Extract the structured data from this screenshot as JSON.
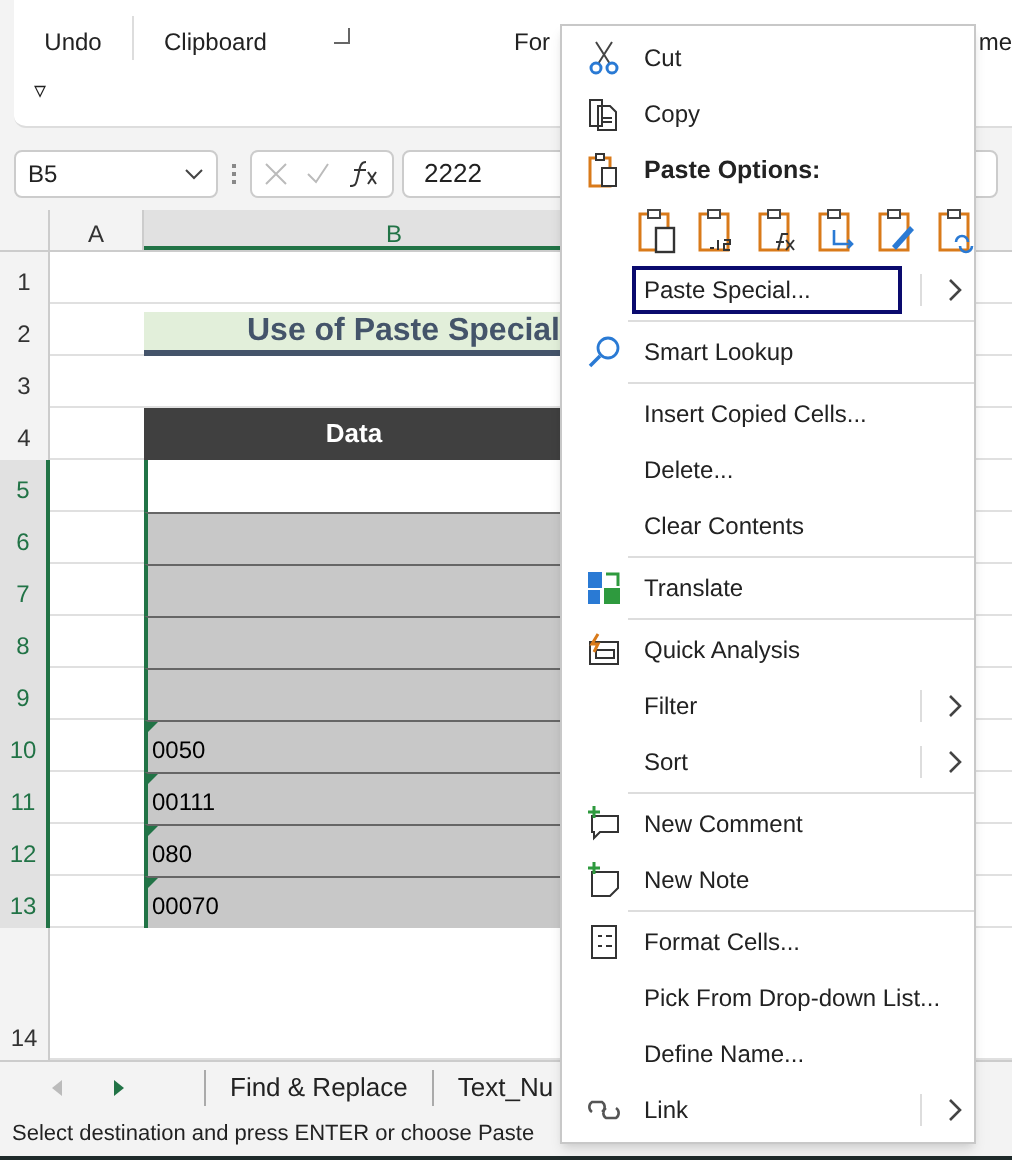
{
  "ribbon": {
    "groups": [
      "Undo",
      "Clipboard",
      "For",
      "me"
    ],
    "collapse": "▿"
  },
  "formula_bar": {
    "name_box": "B5",
    "value": "2222"
  },
  "columns": [
    "A",
    "B"
  ],
  "rows": [
    {
      "header": "1",
      "kind": "blank",
      "value": ""
    },
    {
      "header": "2",
      "kind": "title",
      "value": "Use of Paste Special"
    },
    {
      "header": "3",
      "kind": "blank",
      "value": ""
    },
    {
      "header": "4",
      "kind": "heading",
      "value": "Data"
    },
    {
      "header": "5",
      "kind": "data",
      "value": "",
      "shaded": false,
      "flag": false
    },
    {
      "header": "6",
      "kind": "data",
      "value": "",
      "shaded": true,
      "flag": false
    },
    {
      "header": "7",
      "kind": "data",
      "value": "",
      "shaded": true,
      "flag": false
    },
    {
      "header": "8",
      "kind": "data",
      "value": "",
      "shaded": true,
      "flag": false
    },
    {
      "header": "9",
      "kind": "data",
      "value": "",
      "shaded": true,
      "flag": false
    },
    {
      "header": "10",
      "kind": "data",
      "value": "0050",
      "shaded": true,
      "flag": true
    },
    {
      "header": "11",
      "kind": "data",
      "value": "00111",
      "shaded": true,
      "flag": true
    },
    {
      "header": "12",
      "kind": "data",
      "value": "080",
      "shaded": true,
      "flag": true
    },
    {
      "header": "13",
      "kind": "data",
      "value": "00070",
      "shaded": true,
      "flag": true
    },
    {
      "header": "14",
      "kind": "tall",
      "value": ""
    }
  ],
  "sheet_tabs": [
    "Find & Replace",
    "Text_Nu"
  ],
  "status_bar": "Select destination and press ENTER or choose Paste",
  "context_menu": [
    {
      "kind": "command",
      "label": "Cut",
      "selected": false,
      "submenu": false,
      "separator_before": false
    },
    {
      "kind": "command",
      "label": "Copy",
      "selected": false,
      "submenu": false,
      "separator_before": false
    },
    {
      "kind": "heading",
      "label": "Paste Options:"
    },
    {
      "kind": "paste_row"
    },
    {
      "kind": "command",
      "label": "Paste Special...",
      "selected": true,
      "submenu": true,
      "separator_before": false
    },
    {
      "kind": "command",
      "label": "Smart Lookup",
      "selected": false,
      "submenu": false,
      "separator_before": true
    },
    {
      "kind": "command",
      "label": "Insert Copied Cells...",
      "selected": false,
      "submenu": false,
      "separator_before": true
    },
    {
      "kind": "command",
      "label": "Delete...",
      "selected": false,
      "submenu": false,
      "separator_before": false
    },
    {
      "kind": "command",
      "label": "Clear Contents",
      "selected": false,
      "submenu": false,
      "separator_before": false
    },
    {
      "kind": "command",
      "label": "Translate",
      "selected": false,
      "submenu": false,
      "separator_before": true
    },
    {
      "kind": "command",
      "label": "Quick Analysis",
      "selected": false,
      "submenu": false,
      "separator_before": true
    },
    {
      "kind": "command",
      "label": "Filter",
      "selected": false,
      "submenu": true,
      "separator_before": false
    },
    {
      "kind": "command",
      "label": "Sort",
      "selected": false,
      "submenu": true,
      "separator_before": false
    },
    {
      "kind": "command",
      "label": "New Comment",
      "selected": false,
      "submenu": false,
      "separator_before": true
    },
    {
      "kind": "command",
      "label": "New Note",
      "selected": false,
      "submenu": false,
      "separator_before": false
    },
    {
      "kind": "command",
      "label": "Format Cells...",
      "selected": false,
      "submenu": false,
      "separator_before": true
    },
    {
      "kind": "command",
      "label": "Pick From Drop-down List...",
      "selected": false,
      "submenu": false,
      "separator_before": false
    },
    {
      "kind": "command",
      "label": "Define Name...",
      "selected": false,
      "submenu": false,
      "separator_before": false
    },
    {
      "kind": "command",
      "label": "Link",
      "selected": false,
      "submenu": true,
      "separator_before": false
    }
  ]
}
